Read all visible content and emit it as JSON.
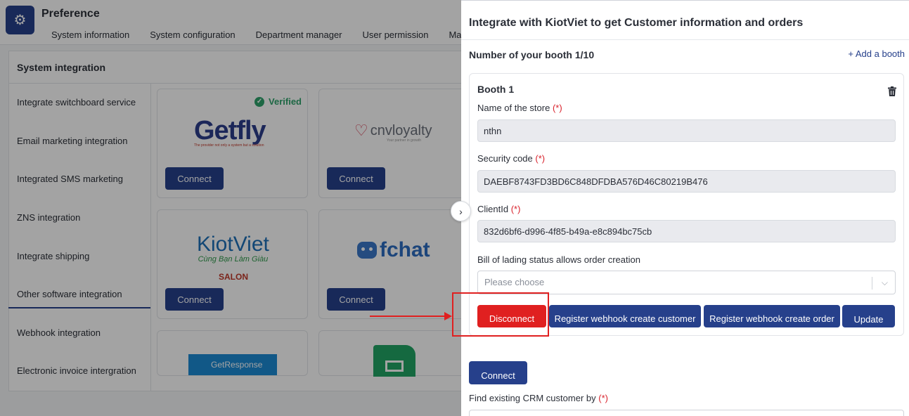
{
  "app": {
    "title": "Preference",
    "tabs": [
      "System information",
      "System configuration",
      "Department manager",
      "User permission",
      "Mana"
    ]
  },
  "section": {
    "title": "System integration"
  },
  "left_menu": [
    "Integrate switchboard service",
    "Email marketing integration",
    "Integrated SMS marketing",
    "ZNS integration",
    "Integrate shipping",
    "Other software integration",
    "Webhook integration",
    "Electronic invoice intergration"
  ],
  "cards": [
    {
      "name": "Getfly",
      "tagline": "The provider not only a system but a solution",
      "verified": "Verified",
      "button": "Connect"
    },
    {
      "name": "cnvloyalty",
      "tagline": "Your partner in growth",
      "button": "Connect"
    },
    {
      "name": "KiotViet",
      "tagline": "Cùng Bạn Làm Giàu",
      "badge": "SALON",
      "button": "Connect"
    },
    {
      "name": "fchat",
      "button": "Connect"
    },
    {
      "name": "GetResponse"
    },
    {
      "name": "google-sheets"
    }
  ],
  "panel": {
    "title": "Integrate with KiotViet to get Customer information and orders",
    "booth_count_label": "Number of your booth 1/10",
    "add_booth": "+ Add a booth",
    "booth": {
      "title": "Booth 1",
      "store_label": "Name of the store",
      "store_value": "nthn",
      "security_label": "Security code",
      "security_value": "DAEBF8743FD3BD6C848DFDBA576D46C80219B476",
      "client_label": "ClientId",
      "client_value": "832d6bf6-d996-4f85-b49a-e8c894bc75cb",
      "status_label": "Bill of lading status allows order creation",
      "status_placeholder": "Please choose",
      "required_mark": "(*)",
      "buttons": {
        "disconnect": "Disconnect",
        "webhook_customer": "Register webhook create customer",
        "webhook_order": "Register webhook create order",
        "update": "Update"
      }
    },
    "connect": "Connect",
    "find_label": "Find existing CRM customer by"
  },
  "colors": {
    "navy": "#26408b",
    "red": "#e02020",
    "green": "#2ea26b"
  },
  "icons": {
    "logo": "gear-icon",
    "delete": "trash-icon",
    "expand": "chevron-right-icon",
    "dropdown": "chevron-down-icon"
  }
}
